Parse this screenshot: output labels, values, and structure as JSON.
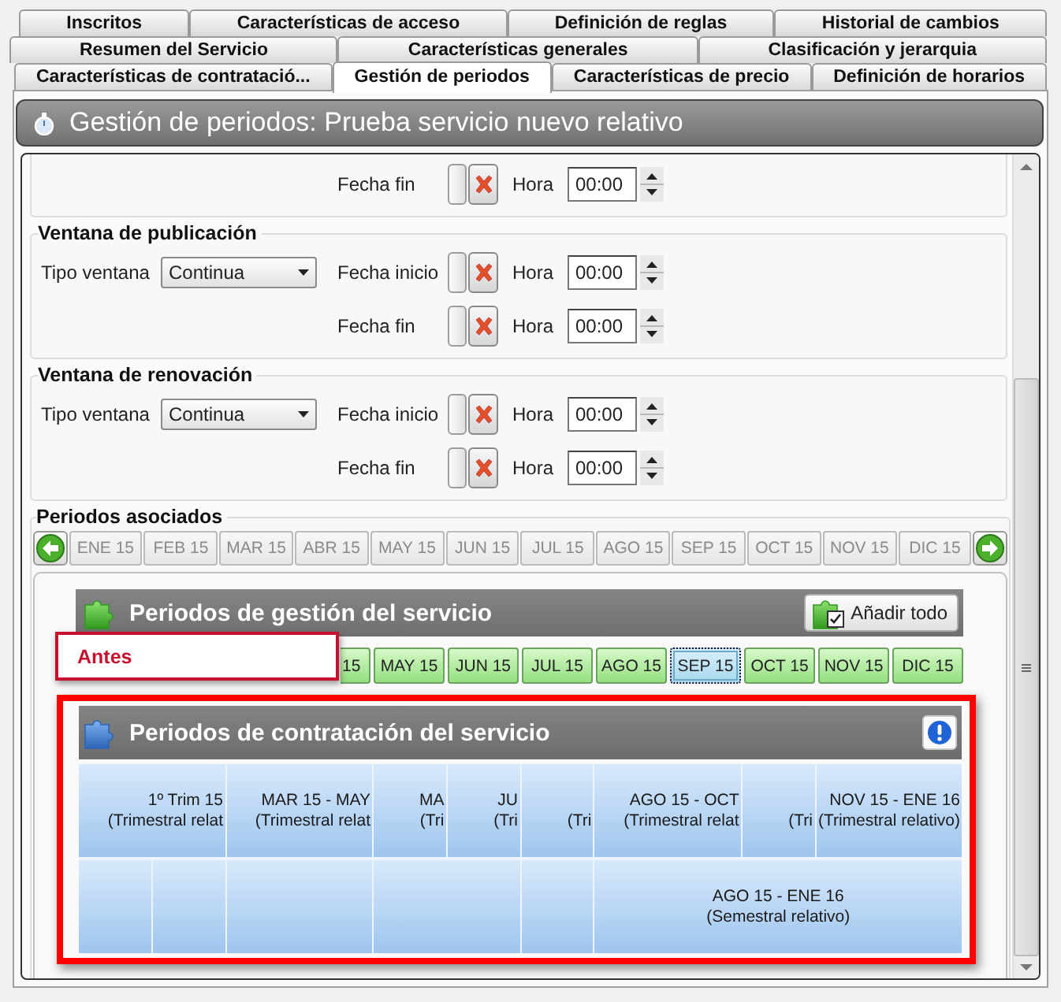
{
  "tab_rows": [
    {
      "tabs": [
        {
          "label": "Inscritos",
          "selected": false
        },
        {
          "label": "Características de acceso",
          "selected": false
        },
        {
          "label": "Definición de reglas",
          "selected": false
        },
        {
          "label": "Historial de cambios",
          "selected": false
        }
      ]
    },
    {
      "tabs": [
        {
          "label": "Resumen del Servicio",
          "selected": false
        },
        {
          "label": "Características generales",
          "selected": false
        },
        {
          "label": "Clasificación y jerarquia",
          "selected": false
        }
      ]
    },
    {
      "tabs": [
        {
          "label": "Características de contratació...",
          "selected": false
        },
        {
          "label": "Gestión de periodos",
          "selected": true
        },
        {
          "label": "Características de precio",
          "selected": false
        },
        {
          "label": "Definición de horarios",
          "selected": false
        }
      ]
    }
  ],
  "title": "Gestión de periodos: Prueba servicio nuevo relativo",
  "windows": [
    {
      "rows": [
        {
          "date_label": "Fecha fin",
          "time_label": "Hora",
          "time": "00:00"
        }
      ]
    },
    {
      "title": "Ventana de publicación",
      "type_label": "Tipo ventana",
      "type_value": "Continua",
      "rows": [
        {
          "date_label": "Fecha inicio",
          "time_label": "Hora",
          "time": "00:00"
        },
        {
          "date_label": "Fecha fin",
          "time_label": "Hora",
          "time": "00:00"
        }
      ]
    },
    {
      "title": "Ventana de renovación",
      "type_label": "Tipo ventana",
      "type_value": "Continua",
      "rows": [
        {
          "date_label": "Fecha inicio",
          "time_label": "Hora",
          "time": "00:00"
        },
        {
          "date_label": "Fecha fin",
          "time_label": "Hora",
          "time": "00:00"
        }
      ]
    }
  ],
  "associated": {
    "title": "Periodos asociados",
    "months": [
      "ENE 15",
      "FEB 15",
      "MAR 15",
      "ABR 15",
      "MAY 15",
      "JUN 15",
      "JUL 15",
      "AGO 15",
      "SEP 15",
      "OCT 15",
      "NOV 15",
      "DIC 15"
    ]
  },
  "management": {
    "title": "Periodos de gestión del servicio",
    "add_all": "Añadir todo",
    "months": [
      {
        "label": "15",
        "selected": false
      },
      {
        "label": "MAY 15",
        "selected": false
      },
      {
        "label": "JUN 15",
        "selected": false
      },
      {
        "label": "JUL 15",
        "selected": false
      },
      {
        "label": "AGO 15",
        "selected": false
      },
      {
        "label": "SEP 15",
        "selected": true
      },
      {
        "label": "OCT 15",
        "selected": false
      },
      {
        "label": "NOV 15",
        "selected": false
      },
      {
        "label": "DIC 15",
        "selected": false
      }
    ]
  },
  "note": "Antes",
  "contracting": {
    "title": "Periodos de contratación del servicio",
    "rows": [
      {
        "cells": [
          {
            "kind": "period",
            "line1": "1º Trim 15",
            "line2": "(Trimestral relat"
          },
          {
            "kind": "period",
            "line1": "MAR 15 - MAY",
            "line2": "(Trimestral relat"
          },
          {
            "kind": "period",
            "line1": "MA",
            "line2": "(Tri"
          },
          {
            "kind": "period",
            "line1": "JU",
            "line2": "(Tri"
          },
          {
            "kind": "period",
            "line2": "(Tri"
          },
          {
            "kind": "period",
            "line1": "AGO 15 - OCT",
            "line2": "(Trimestral relat"
          },
          {
            "kind": "period",
            "line2": "(Tri"
          },
          {
            "kind": "period",
            "line1": "NOV 15 - ENE 16",
            "line2": "(Trimestral relativo)"
          }
        ]
      },
      {
        "cells": [
          {
            "kind": "empty"
          },
          {
            "kind": "empty"
          },
          {
            "kind": "empty"
          },
          {
            "kind": "empty"
          },
          {
            "kind": "empty"
          },
          {
            "kind": "period",
            "line1": "AGO 15 - ENE 16",
            "line2": "(Semestral relativo)"
          }
        ]
      }
    ]
  }
}
